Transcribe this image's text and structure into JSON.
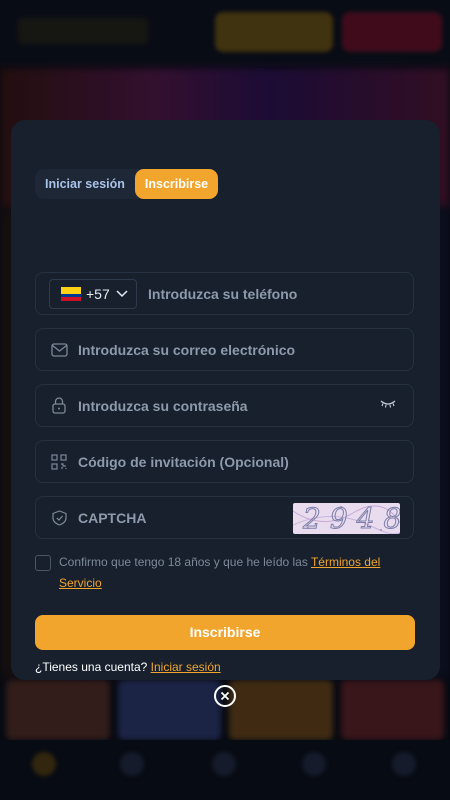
{
  "tabs": {
    "login": "Iniciar sesión",
    "register": "Inscribirse"
  },
  "phone": {
    "country_code": "+57",
    "placeholder": "Introduzca su teléfono",
    "flag": "colombia-flag"
  },
  "email": {
    "placeholder": "Introduzca su correo electrónico"
  },
  "password": {
    "placeholder": "Introduzca su contraseña"
  },
  "invite": {
    "placeholder": "Código de invitación (Opcional)"
  },
  "captcha": {
    "placeholder": "CAPTCHA",
    "image_text": "2948"
  },
  "terms": {
    "text": "Confirmo que tengo 18 años y que he leído las ",
    "link": "Términos del Servicio"
  },
  "submit_label": "Inscribirse",
  "footer": {
    "question": "¿Tienes una cuenta? ",
    "link": "Iniciar sesión"
  },
  "colors": {
    "accent": "#f2a52c",
    "modal_bg": "#17202c",
    "field_border": "#263242",
    "tab_inactive": "#a9c2e8"
  }
}
